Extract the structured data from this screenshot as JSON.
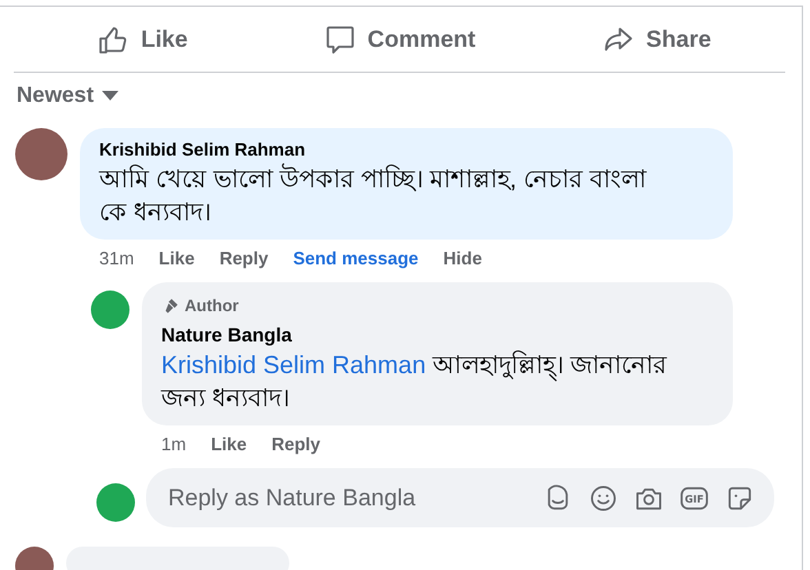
{
  "actions": [
    {
      "kind": "like",
      "label": "Like"
    },
    {
      "kind": "comment",
      "label": "Comment"
    },
    {
      "kind": "share",
      "label": "Share"
    }
  ],
  "sort": {
    "label": "Newest"
  },
  "comments": [
    {
      "kind": "full",
      "author": "Krishibid Selim Rahman",
      "text": "আমি খেয়ে ভালো উপকার পাচ্ছি। মাশাল্লাহ, নেচার বাংলা কে ধন্যবাদ।",
      "time": "31m",
      "links": [
        {
          "label": "Like",
          "highlight": false
        },
        {
          "label": "Reply",
          "highlight": false
        },
        {
          "label": "Send message",
          "highlight": true
        },
        {
          "label": "Hide",
          "highlight": false
        }
      ],
      "replies": [
        {
          "badge": "Author",
          "author": "Nature Bangla",
          "mention": "Krishibid Selim Rahman",
          "text": "আলহাদুল্লিাহ্। জানানোর জন্য ধন্যবাদ।",
          "time": "1m",
          "links": [
            {
              "label": "Like",
              "highlight": false
            },
            {
              "label": "Reply",
              "highlight": false
            }
          ]
        }
      ],
      "composer": {
        "placeholder": "Reply as Nature Bangla",
        "tools": [
          {
            "kind": "avatar-sticker"
          },
          {
            "kind": "emoji"
          },
          {
            "kind": "camera"
          },
          {
            "kind": "gif",
            "label": "GIF"
          },
          {
            "kind": "sticker"
          }
        ]
      }
    },
    {
      "kind": "cut-off"
    }
  ]
}
